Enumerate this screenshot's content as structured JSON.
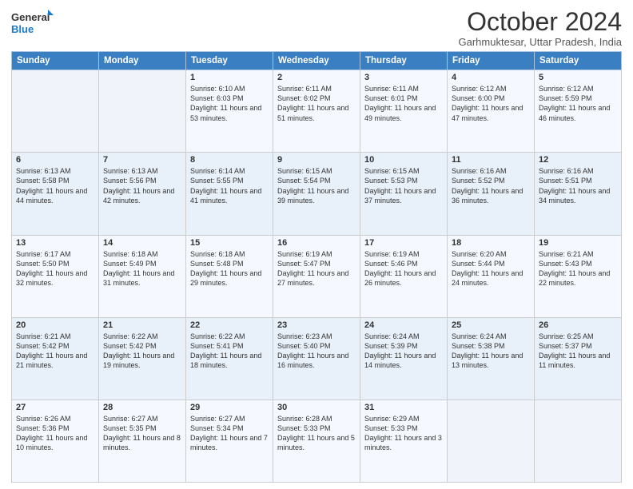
{
  "logo": {
    "line1": "General",
    "line2": "Blue"
  },
  "title": "October 2024",
  "subtitle": "Garhmuktesar, Uttar Pradesh, India",
  "weekdays": [
    "Sunday",
    "Monday",
    "Tuesday",
    "Wednesday",
    "Thursday",
    "Friday",
    "Saturday"
  ],
  "weeks": [
    [
      {
        "day": "",
        "info": ""
      },
      {
        "day": "",
        "info": ""
      },
      {
        "day": "1",
        "info": "Sunrise: 6:10 AM\nSunset: 6:03 PM\nDaylight: 11 hours and 53 minutes."
      },
      {
        "day": "2",
        "info": "Sunrise: 6:11 AM\nSunset: 6:02 PM\nDaylight: 11 hours and 51 minutes."
      },
      {
        "day": "3",
        "info": "Sunrise: 6:11 AM\nSunset: 6:01 PM\nDaylight: 11 hours and 49 minutes."
      },
      {
        "day": "4",
        "info": "Sunrise: 6:12 AM\nSunset: 6:00 PM\nDaylight: 11 hours and 47 minutes."
      },
      {
        "day": "5",
        "info": "Sunrise: 6:12 AM\nSunset: 5:59 PM\nDaylight: 11 hours and 46 minutes."
      }
    ],
    [
      {
        "day": "6",
        "info": "Sunrise: 6:13 AM\nSunset: 5:58 PM\nDaylight: 11 hours and 44 minutes."
      },
      {
        "day": "7",
        "info": "Sunrise: 6:13 AM\nSunset: 5:56 PM\nDaylight: 11 hours and 42 minutes."
      },
      {
        "day": "8",
        "info": "Sunrise: 6:14 AM\nSunset: 5:55 PM\nDaylight: 11 hours and 41 minutes."
      },
      {
        "day": "9",
        "info": "Sunrise: 6:15 AM\nSunset: 5:54 PM\nDaylight: 11 hours and 39 minutes."
      },
      {
        "day": "10",
        "info": "Sunrise: 6:15 AM\nSunset: 5:53 PM\nDaylight: 11 hours and 37 minutes."
      },
      {
        "day": "11",
        "info": "Sunrise: 6:16 AM\nSunset: 5:52 PM\nDaylight: 11 hours and 36 minutes."
      },
      {
        "day": "12",
        "info": "Sunrise: 6:16 AM\nSunset: 5:51 PM\nDaylight: 11 hours and 34 minutes."
      }
    ],
    [
      {
        "day": "13",
        "info": "Sunrise: 6:17 AM\nSunset: 5:50 PM\nDaylight: 11 hours and 32 minutes."
      },
      {
        "day": "14",
        "info": "Sunrise: 6:18 AM\nSunset: 5:49 PM\nDaylight: 11 hours and 31 minutes."
      },
      {
        "day": "15",
        "info": "Sunrise: 6:18 AM\nSunset: 5:48 PM\nDaylight: 11 hours and 29 minutes."
      },
      {
        "day": "16",
        "info": "Sunrise: 6:19 AM\nSunset: 5:47 PM\nDaylight: 11 hours and 27 minutes."
      },
      {
        "day": "17",
        "info": "Sunrise: 6:19 AM\nSunset: 5:46 PM\nDaylight: 11 hours and 26 minutes."
      },
      {
        "day": "18",
        "info": "Sunrise: 6:20 AM\nSunset: 5:44 PM\nDaylight: 11 hours and 24 minutes."
      },
      {
        "day": "19",
        "info": "Sunrise: 6:21 AM\nSunset: 5:43 PM\nDaylight: 11 hours and 22 minutes."
      }
    ],
    [
      {
        "day": "20",
        "info": "Sunrise: 6:21 AM\nSunset: 5:42 PM\nDaylight: 11 hours and 21 minutes."
      },
      {
        "day": "21",
        "info": "Sunrise: 6:22 AM\nSunset: 5:42 PM\nDaylight: 11 hours and 19 minutes."
      },
      {
        "day": "22",
        "info": "Sunrise: 6:22 AM\nSunset: 5:41 PM\nDaylight: 11 hours and 18 minutes."
      },
      {
        "day": "23",
        "info": "Sunrise: 6:23 AM\nSunset: 5:40 PM\nDaylight: 11 hours and 16 minutes."
      },
      {
        "day": "24",
        "info": "Sunrise: 6:24 AM\nSunset: 5:39 PM\nDaylight: 11 hours and 14 minutes."
      },
      {
        "day": "25",
        "info": "Sunrise: 6:24 AM\nSunset: 5:38 PM\nDaylight: 11 hours and 13 minutes."
      },
      {
        "day": "26",
        "info": "Sunrise: 6:25 AM\nSunset: 5:37 PM\nDaylight: 11 hours and 11 minutes."
      }
    ],
    [
      {
        "day": "27",
        "info": "Sunrise: 6:26 AM\nSunset: 5:36 PM\nDaylight: 11 hours and 10 minutes."
      },
      {
        "day": "28",
        "info": "Sunrise: 6:27 AM\nSunset: 5:35 PM\nDaylight: 11 hours and 8 minutes."
      },
      {
        "day": "29",
        "info": "Sunrise: 6:27 AM\nSunset: 5:34 PM\nDaylight: 11 hours and 7 minutes."
      },
      {
        "day": "30",
        "info": "Sunrise: 6:28 AM\nSunset: 5:33 PM\nDaylight: 11 hours and 5 minutes."
      },
      {
        "day": "31",
        "info": "Sunrise: 6:29 AM\nSunset: 5:33 PM\nDaylight: 11 hours and 3 minutes."
      },
      {
        "day": "",
        "info": ""
      },
      {
        "day": "",
        "info": ""
      }
    ]
  ]
}
